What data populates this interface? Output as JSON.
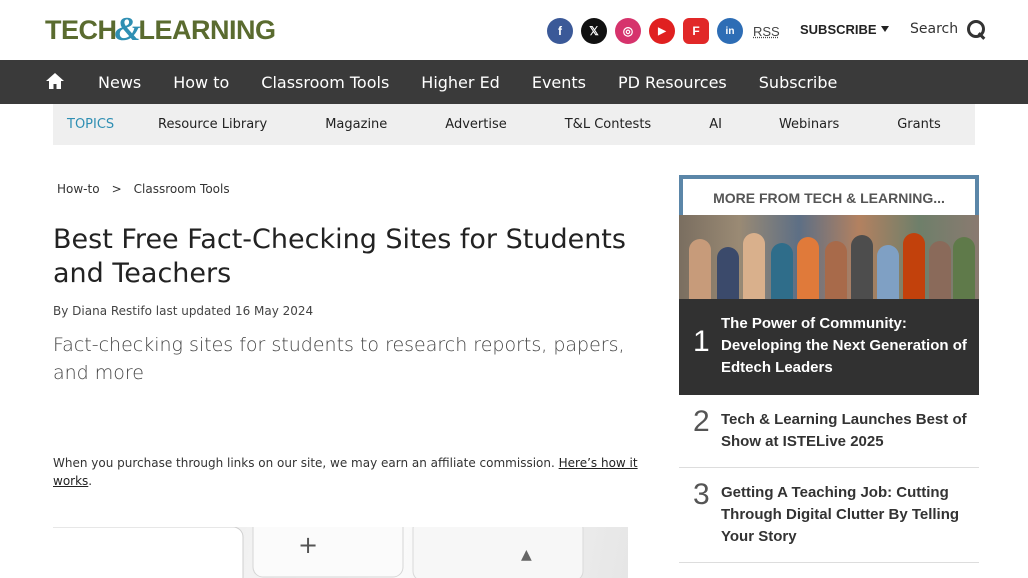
{
  "header": {
    "logo_left": "TECH",
    "logo_amp": "&",
    "logo_right": "LEARNING",
    "socials": [
      {
        "name": "facebook-icon",
        "glyph": "f",
        "color": "#3b5998"
      },
      {
        "name": "x-icon",
        "glyph": "𝕏",
        "color": "#111111"
      },
      {
        "name": "instagram-icon",
        "glyph": "◎",
        "color": "#d6336c"
      },
      {
        "name": "youtube-icon",
        "glyph": "▶",
        "color": "#e02020"
      },
      {
        "name": "flipboard-icon",
        "glyph": "F",
        "color": "#e12828"
      },
      {
        "name": "linkedin-icon",
        "glyph": "in",
        "color": "#2d6db5"
      }
    ],
    "rss_label": "RSS",
    "subscribe_label": "SUBSCRIBE",
    "search_label": "Search"
  },
  "nav": {
    "items": [
      "News",
      "How to",
      "Classroom Tools",
      "Higher Ed",
      "Events",
      "PD Resources",
      "Subscribe"
    ]
  },
  "topics": {
    "label": "TOPICS",
    "items": [
      "Resource Library",
      "Magazine",
      "Advertise",
      "T&L Contests",
      "AI",
      "Webinars",
      "Grants"
    ]
  },
  "article": {
    "breadcrumb": [
      "How-to",
      ">",
      "Classroom Tools"
    ],
    "title": "Best Free Fact-Checking Sites for Students and Teachers",
    "byline_prefix": "By",
    "author": "Diana Restifo",
    "updated_label": "last updated",
    "date": "16 May 2024",
    "subtitle": "Fact-checking sites for students to research reports, papers, and more",
    "affiliate_text": "When you purchase through links on our site, we may earn an affiliate commission.",
    "affiliate_link": "Here’s how it works",
    "affiliate_end": "."
  },
  "sidebar": {
    "heading": "MORE FROM TECH & LEARNING...",
    "featured": {
      "rank": "1",
      "title": "The Power of Community: Developing the Next Generation of Edtech Leaders"
    },
    "items": [
      {
        "rank": "2",
        "title": "Tech & Learning Launches Best of Show at ISTELive 2025"
      },
      {
        "rank": "3",
        "title": "Getting A Teaching Job: Cutting Through Digital Clutter By Telling Your Story"
      }
    ]
  }
}
